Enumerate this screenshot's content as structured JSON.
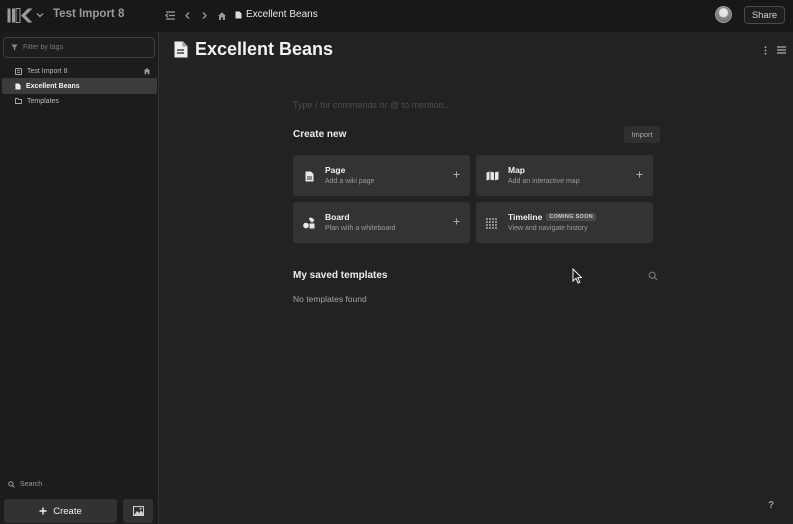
{
  "topbar": {
    "workspace_title": "Test Import 8",
    "breadcrumb_page": "Excellent Beans",
    "share_label": "Share"
  },
  "sidebar": {
    "filter_placeholder": "Filter by tags",
    "items": [
      {
        "label": "Test Import 8",
        "icon": "book-icon",
        "active": false
      },
      {
        "label": "Excellent Beans",
        "icon": "page-icon",
        "active": true
      },
      {
        "label": "Templates",
        "icon": "folder-icon",
        "active": false
      }
    ],
    "search_label": "Search",
    "create_label": "Create"
  },
  "main": {
    "page_title": "Excellent Beans",
    "editor_placeholder": "Type / for commands or @ to mention...",
    "create_new_title": "Create new",
    "import_label": "Import",
    "cards": [
      {
        "title": "Page",
        "subtitle": "Add a wiki page",
        "icon": "page-icon",
        "badge": ""
      },
      {
        "title": "Map",
        "subtitle": "Add an interactive map",
        "icon": "map-icon",
        "badge": ""
      },
      {
        "title": "Board",
        "subtitle": "Plan with a whiteboard",
        "icon": "shapes-icon",
        "badge": ""
      },
      {
        "title": "Timeline",
        "subtitle": "View and navigate history",
        "icon": "timeline-icon",
        "badge": "COMING SOON"
      }
    ],
    "saved_templates_title": "My saved templates",
    "no_templates": "No templates found",
    "help_label": "?"
  }
}
